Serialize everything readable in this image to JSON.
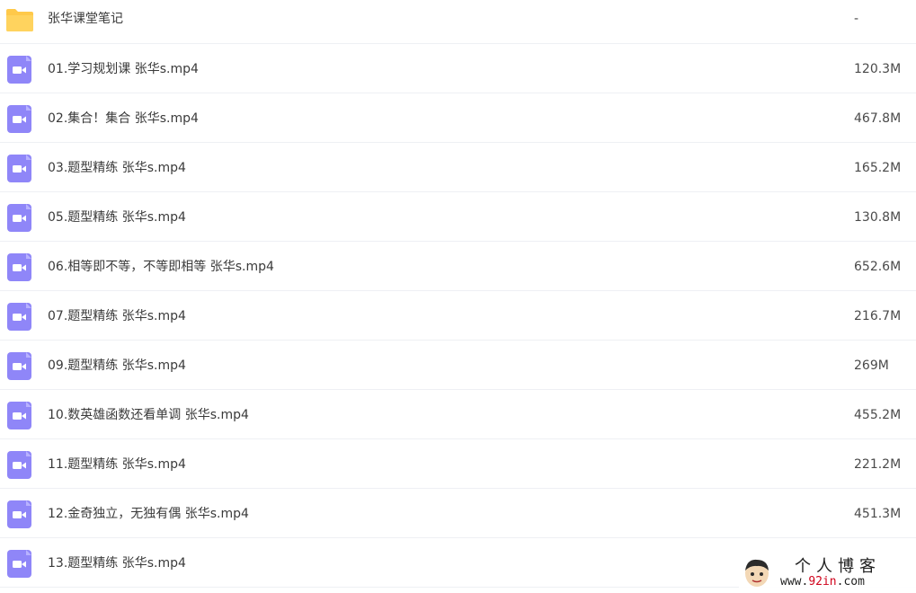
{
  "colors": {
    "video_icon": "#8f86f8",
    "folder_icon": "#ffc94a",
    "row_border": "#eef0f4"
  },
  "folder": {
    "icon": "folder-icon",
    "name": "张华课堂笔记",
    "size": "-"
  },
  "files": [
    {
      "icon": "video-icon",
      "name": "01.学习规划课 张华s.mp4",
      "size": "120.3M"
    },
    {
      "icon": "video-icon",
      "name": "02.集合！集合 张华s.mp4",
      "size": "467.8M"
    },
    {
      "icon": "video-icon",
      "name": "03.题型精练 张华s.mp4",
      "size": "165.2M"
    },
    {
      "icon": "video-icon",
      "name": "05.题型精练 张华s.mp4",
      "size": "130.8M"
    },
    {
      "icon": "video-icon",
      "name": "06.相等即不等，不等即相等 张华s.mp4",
      "size": "652.6M"
    },
    {
      "icon": "video-icon",
      "name": "07.题型精练 张华s.mp4",
      "size": "216.7M"
    },
    {
      "icon": "video-icon",
      "name": "09.题型精练 张华s.mp4",
      "size": "269M"
    },
    {
      "icon": "video-icon",
      "name": "10.数英雄函数还看单调 张华s.mp4",
      "size": "455.2M"
    },
    {
      "icon": "video-icon",
      "name": "11.题型精练 张华s.mp4",
      "size": "221.2M"
    },
    {
      "icon": "video-icon",
      "name": "12.金奇独立，无独有偶 张华s.mp4",
      "size": "451.3M"
    },
    {
      "icon": "video-icon",
      "name": "13.题型精练 张华s.mp4",
      "size": ""
    }
  ],
  "watermark": {
    "title": "个人博客",
    "url_prefix": "www.",
    "url_highlight": "92in",
    "url_suffix": ".com"
  }
}
